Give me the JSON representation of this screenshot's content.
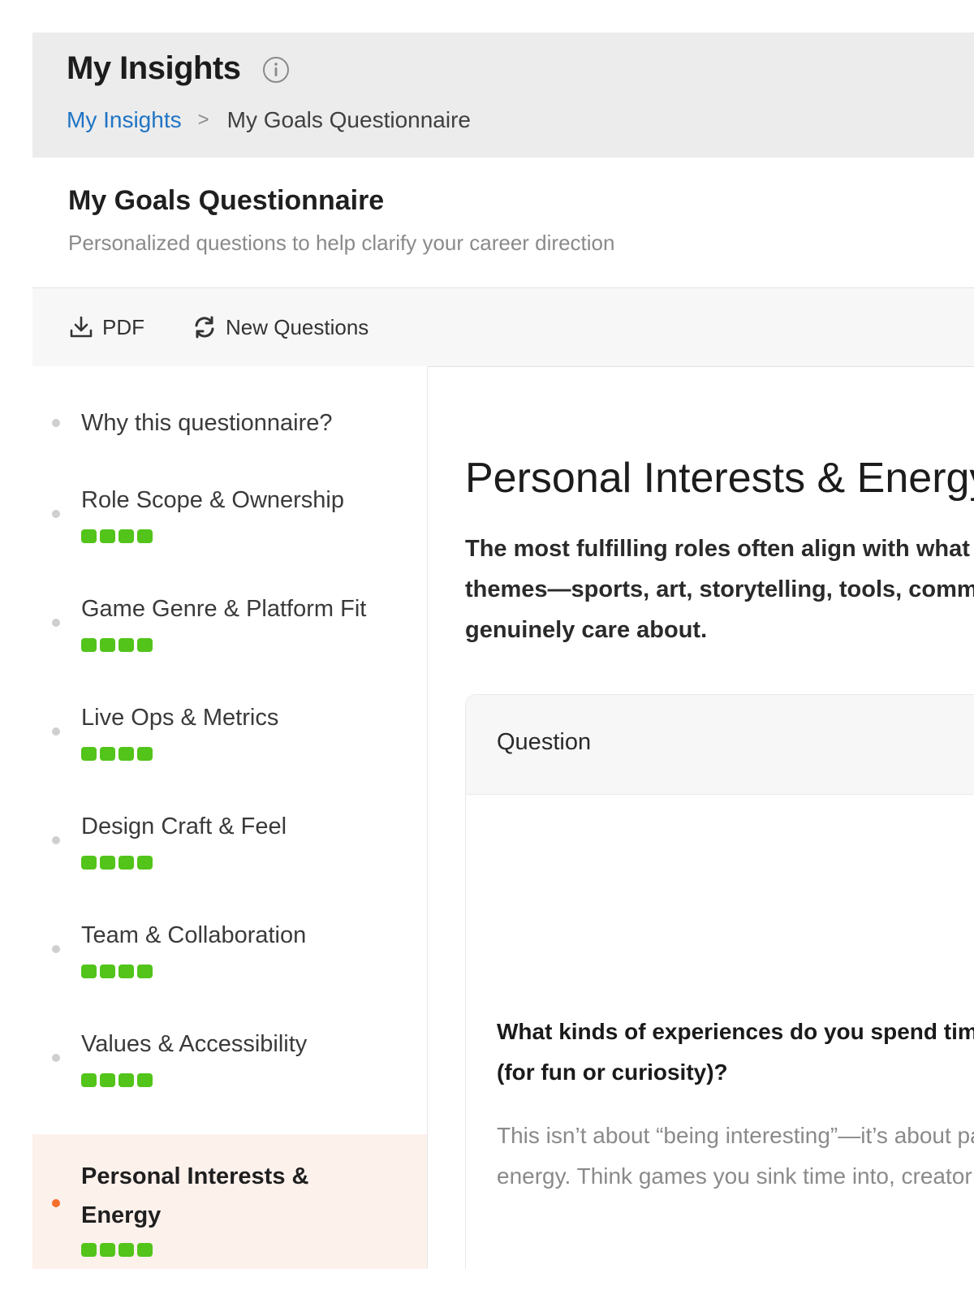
{
  "header": {
    "title": "My Insights",
    "breadcrumb": {
      "parent": "My Insights",
      "separator": ">",
      "current": "My Goals Questionnaire"
    }
  },
  "page": {
    "title": "My Goals Questionnaire",
    "subtitle": "Personalized questions to help clarify your career direction"
  },
  "toolbar": {
    "pdf_label": "PDF",
    "new_questions_label": "New Questions"
  },
  "sidebar": {
    "items": [
      {
        "label": "Why this questionnaire?",
        "progress": null
      },
      {
        "label": "Role Scope & Ownership",
        "progress": 4
      },
      {
        "label": "Game Genre & Platform Fit",
        "progress": 4
      },
      {
        "label": "Live Ops & Metrics",
        "progress": 4
      },
      {
        "label": "Design Craft & Feel",
        "progress": 4
      },
      {
        "label": "Team & Collaboration",
        "progress": 4
      },
      {
        "label": "Values & Accessibility",
        "progress": 4
      },
      {
        "label": "Personal Interests & Energy",
        "progress": 4,
        "active": true
      }
    ]
  },
  "main": {
    "section_title": "Personal Interests & Energy",
    "intro": "The most fulfilling roles often align with what you do for fun — themes—sports, art, storytelling, tools, communities you genuinely care about.",
    "card": {
      "header_label": "Question",
      "question": "What kinds of experiences do you spend time with outside of work (for fun or curiosity)?",
      "hint": "This isn’t about “being interesting”—it’s about patterns in what gives you energy. Think games you sink time into, creator tools you tinker with"
    }
  },
  "colors": {
    "link": "#1f74c4",
    "progress": "#52c41a",
    "active_dot": "#f5712b",
    "active_bg": "#fdf1ec"
  },
  "icons": {
    "info": "info-icon",
    "pdf": "download-icon",
    "new_questions": "refresh-icon"
  }
}
